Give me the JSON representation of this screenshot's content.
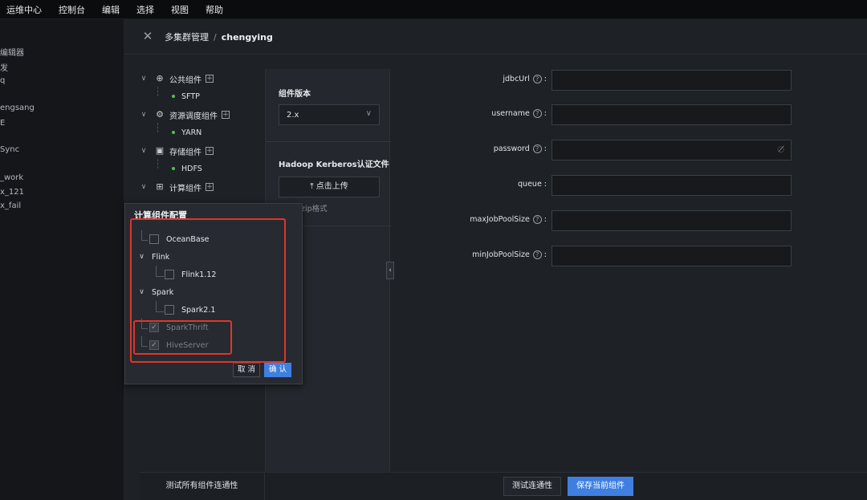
{
  "menubar": [
    "运维中心",
    "控制台",
    "编辑",
    "选择",
    "视图",
    "帮助"
  ],
  "sidebar_fragments": [
    "编辑器",
    "发",
    "q",
    "engsang",
    "E",
    "Sync",
    "_work",
    "x_121",
    "x_fail"
  ],
  "header": {
    "breadcrumb_parent": "多集群管理",
    "separator": "/",
    "breadcrumb_current": "chengying"
  },
  "tree": {
    "groups": [
      {
        "label": "公共组件",
        "icon": "globe-icon",
        "children": [
          "SFTP"
        ]
      },
      {
        "label": "资源调度组件",
        "icon": "cluster-icon",
        "children": [
          "YARN"
        ]
      },
      {
        "label": "存储组件",
        "icon": "save-icon",
        "children": [
          "HDFS"
        ]
      },
      {
        "label": "计算组件",
        "icon": "calculator-icon",
        "children": []
      }
    ]
  },
  "middle": {
    "version_title": "组件版本",
    "version_value": "2.x",
    "kerberos_title": "Hadoop Kerberos认证文件",
    "upload_label": "点击上传",
    "upload_hint": "zip格式"
  },
  "form": {
    "fields": [
      {
        "label": "jdbcUrl",
        "help": true,
        "value": ""
      },
      {
        "label": "username",
        "help": true,
        "value": ""
      },
      {
        "label": "password",
        "help": true,
        "value": ""
      },
      {
        "label": "queue",
        "help": false,
        "value": ""
      },
      {
        "label": "maxJobPoolSize",
        "help": true,
        "value": ""
      },
      {
        "label": "minJobPoolSize",
        "help": true,
        "value": ""
      }
    ],
    "colon": ":"
  },
  "footer": {
    "test_all_label": "测试所有组件连通性",
    "test_label": "测试连通性",
    "save_label": "保存当前组件"
  },
  "popover": {
    "title": "计算组件配置",
    "items": [
      {
        "label": "OceanBase",
        "type": "checkbox",
        "checked": false,
        "disabled": false
      },
      {
        "label": "Flink",
        "type": "group"
      },
      {
        "label": "Flink1.12",
        "type": "checkbox",
        "checked": false,
        "disabled": false
      },
      {
        "label": "Spark",
        "type": "group"
      },
      {
        "label": "Spark2.1",
        "type": "checkbox",
        "checked": false,
        "disabled": false
      },
      {
        "label": "SparkThrift",
        "type": "checkbox",
        "checked": true,
        "disabled": true
      },
      {
        "label": "HiveServer",
        "type": "checkbox",
        "checked": true,
        "disabled": true
      }
    ],
    "cancel_label": "取 消",
    "confirm_label": "确 认"
  },
  "colors": {
    "accent": "#3f7fe0",
    "status_ok": "#4fc24f",
    "annotation": "#e0352b"
  }
}
